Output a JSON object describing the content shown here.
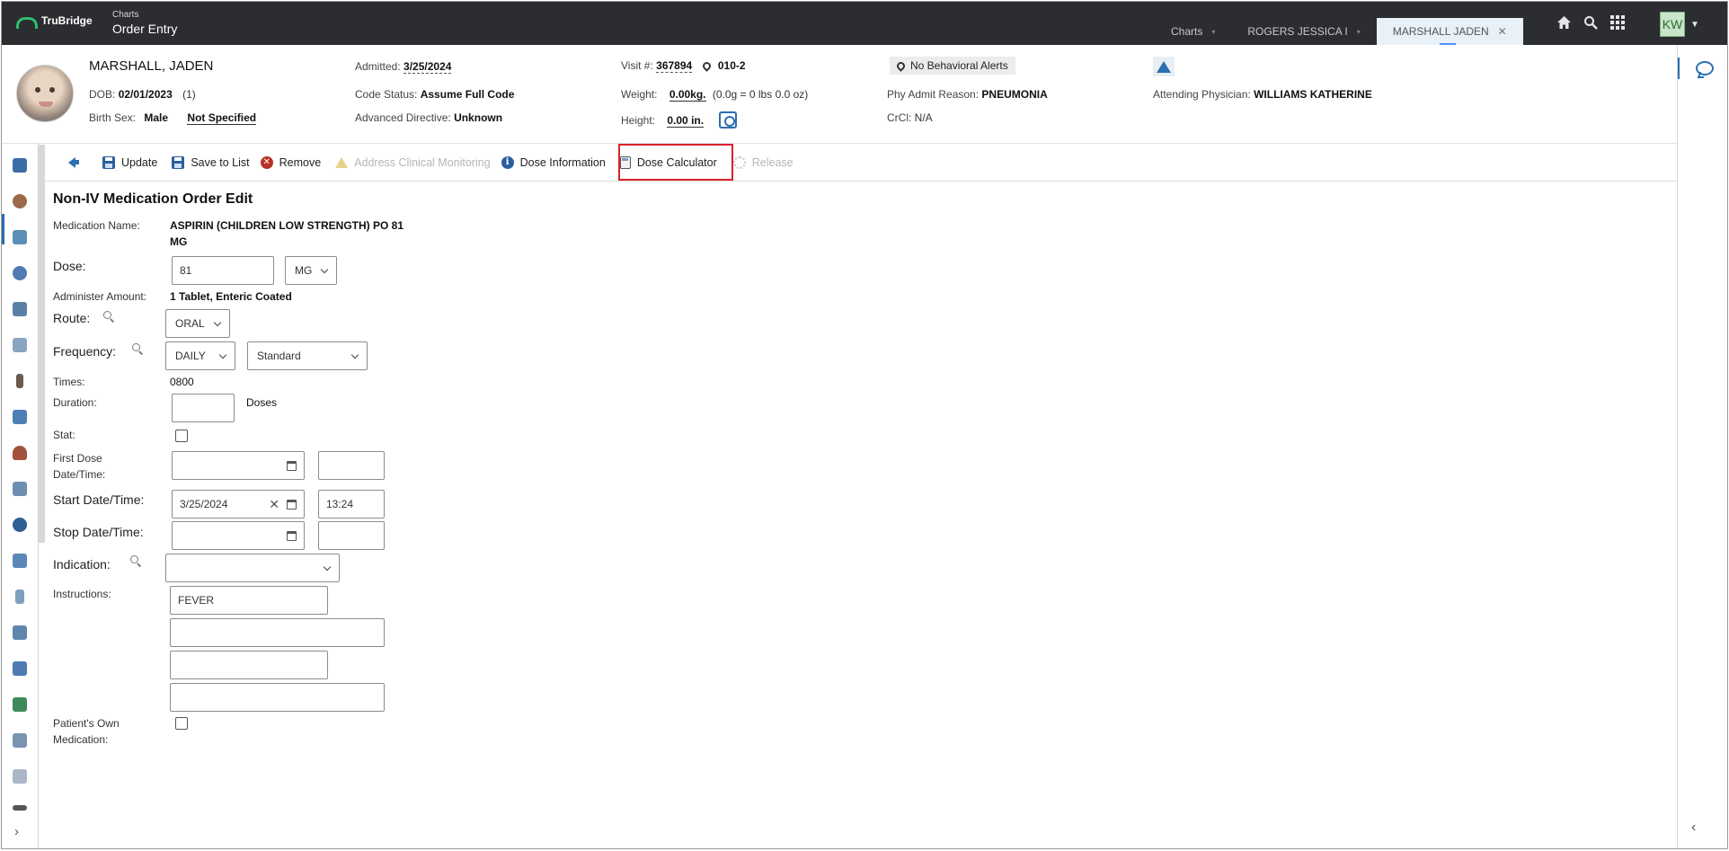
{
  "app": {
    "brand": "TruBridge",
    "breadcrumb": "Charts",
    "module_title": "Order Entry"
  },
  "tabs": [
    {
      "label": "Charts",
      "active": false
    },
    {
      "label": "ROGERS JESSICA I",
      "active": false
    },
    {
      "label": "MARSHALL JADEN",
      "active": true
    }
  ],
  "top_icons": [
    "home-icon",
    "search-icon",
    "apps-grid-icon"
  ],
  "user": {
    "initials": "KW"
  },
  "patient": {
    "last_name": "MARSHALL",
    "first_name": ", JADEN",
    "dob_label": "DOB:",
    "dob": "02/01/2023",
    "age": "(1)",
    "birth_sex_label": "Birth Sex:",
    "birth_sex": "Male",
    "gender_identity": "Not Specified",
    "admitted_label": "Admitted:",
    "admitted": "3/25/2024",
    "code_status_label": "Code Status:",
    "code_status": "Assume Full Code",
    "advanced_directive_label": "Advanced Directive:",
    "advanced_directive": "Unknown",
    "visit_label": "Visit #:",
    "visit": "367894",
    "room": "010-2",
    "weight_label": "Weight:",
    "weight": "0.00kg.",
    "weight_detail": "(0.0g = 0 lbs 0.0 oz)",
    "height_label": "Height:",
    "height": "0.00 in.",
    "behavioral_alerts": "No Behavioral Alerts",
    "phy_admit_reason_label": "Phy Admit Reason:",
    "phy_admit_reason": "PNEUMONIA",
    "crcl_label": "CrCl:",
    "crcl": "N/A",
    "attending_label": "Attending Physician:",
    "attending": "WILLIAMS KATHERINE"
  },
  "toolbar": {
    "update": "Update",
    "save_to_list": "Save to List",
    "remove": "Remove",
    "address_clinical_monitoring": "Address Clinical Monitoring",
    "dose_information": "Dose Information",
    "dose_calculator": "Dose Calculator",
    "release": "Release"
  },
  "form": {
    "title": "Non-IV Medication Order Edit",
    "medication_name_label": "Medication Name:",
    "medication_name_line1": "ASPIRIN (CHILDREN LOW STRENGTH) PO 81",
    "medication_name_line2": "MG",
    "dose_label": "Dose:",
    "dose_value": "81",
    "dose_unit": "MG",
    "administer_amount_label": "Administer Amount:",
    "administer_amount": "1 Tablet, Enteric Coated",
    "route_label": "Route:",
    "route": "ORAL",
    "frequency_label": "Frequency:",
    "frequency": "DAILY",
    "frequency_schedule": "Standard",
    "times_label": "Times:",
    "times": "0800",
    "duration_label": "Duration:",
    "duration_value": "",
    "duration_unit": "Doses",
    "stat_label": "Stat:",
    "first_dose_label_1": "First Dose",
    "first_dose_label_2": "Date/Time:",
    "first_dose_date": "",
    "first_dose_time": "",
    "start_label": "Start Date/Time:",
    "start_date": "3/25/2024",
    "start_time": "13:24",
    "stop_label": "Stop Date/Time:",
    "stop_date": "",
    "stop_time": "",
    "indication_label": "Indication:",
    "indication": "",
    "instructions_label": "Instructions:",
    "instructions": [
      "FEVER",
      "",
      "",
      ""
    ],
    "patients_own_label_1": "Patient's Own",
    "patients_own_label_2": "Medication:"
  },
  "colors": {
    "topbar": "#2b2d30",
    "accent": "#2a6fb0",
    "highlight": "#d9232a"
  }
}
